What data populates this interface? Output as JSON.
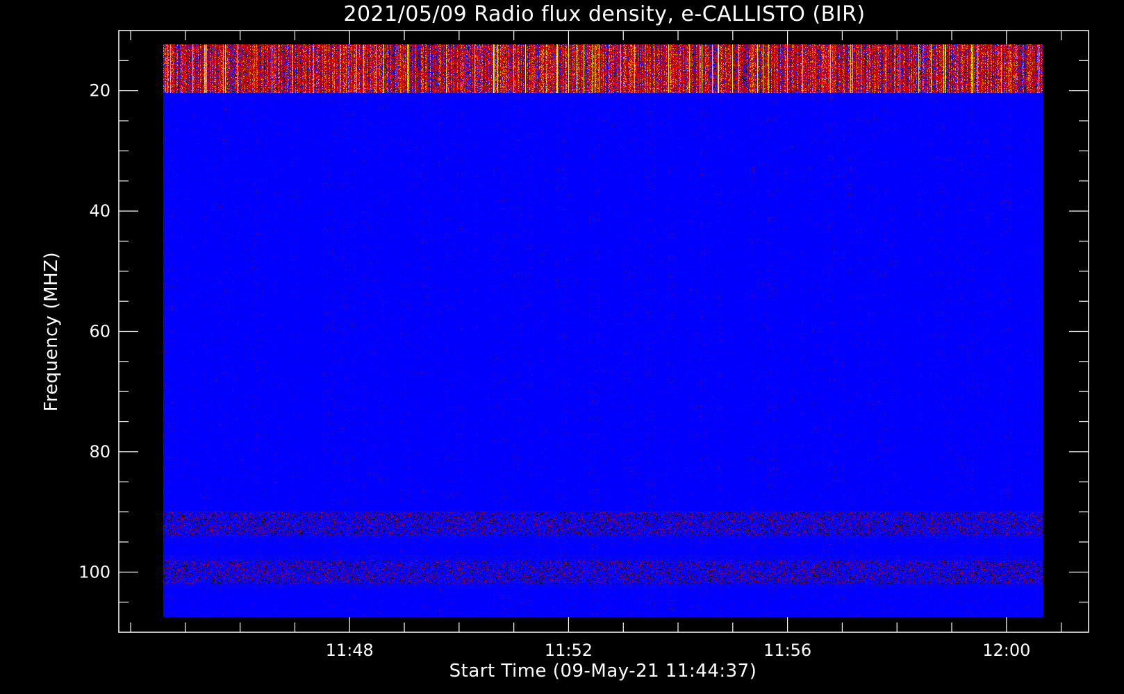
{
  "chart_data": {
    "type": "heatmap",
    "title": "2021/05/09  Radio flux density, e-CALLISTO (BIR)",
    "xlabel": "Start Time (09-May-21 11:44:37)",
    "ylabel": "Frequency (MHZ)",
    "x": {
      "unit": "minutes",
      "data_start": "11:44:37",
      "data_end": "12:00:00",
      "range": [
        "11:43:47",
        "12:01:30"
      ],
      "major_ticks": [
        "11:48",
        "11:52",
        "11:56",
        "12:00"
      ]
    },
    "y": {
      "unit": "MHz",
      "range": [
        10,
        110
      ],
      "inverted": true,
      "data_range": [
        10,
        105.5
      ],
      "major_ticks": [
        20,
        40,
        60,
        80,
        100
      ]
    },
    "colormap": {
      "background_color": "#0000ff",
      "scale": [
        "#000000",
        "#0000ff",
        "#8b0050",
        "#e00000",
        "#ff8000",
        "#ffff40"
      ]
    },
    "features": {
      "strong_emission_band_mhz": [
        10,
        18
      ],
      "moderate_emission_bands_mhz": [
        [
          88,
          92
        ],
        [
          96,
          100
        ]
      ],
      "grid": false
    }
  }
}
